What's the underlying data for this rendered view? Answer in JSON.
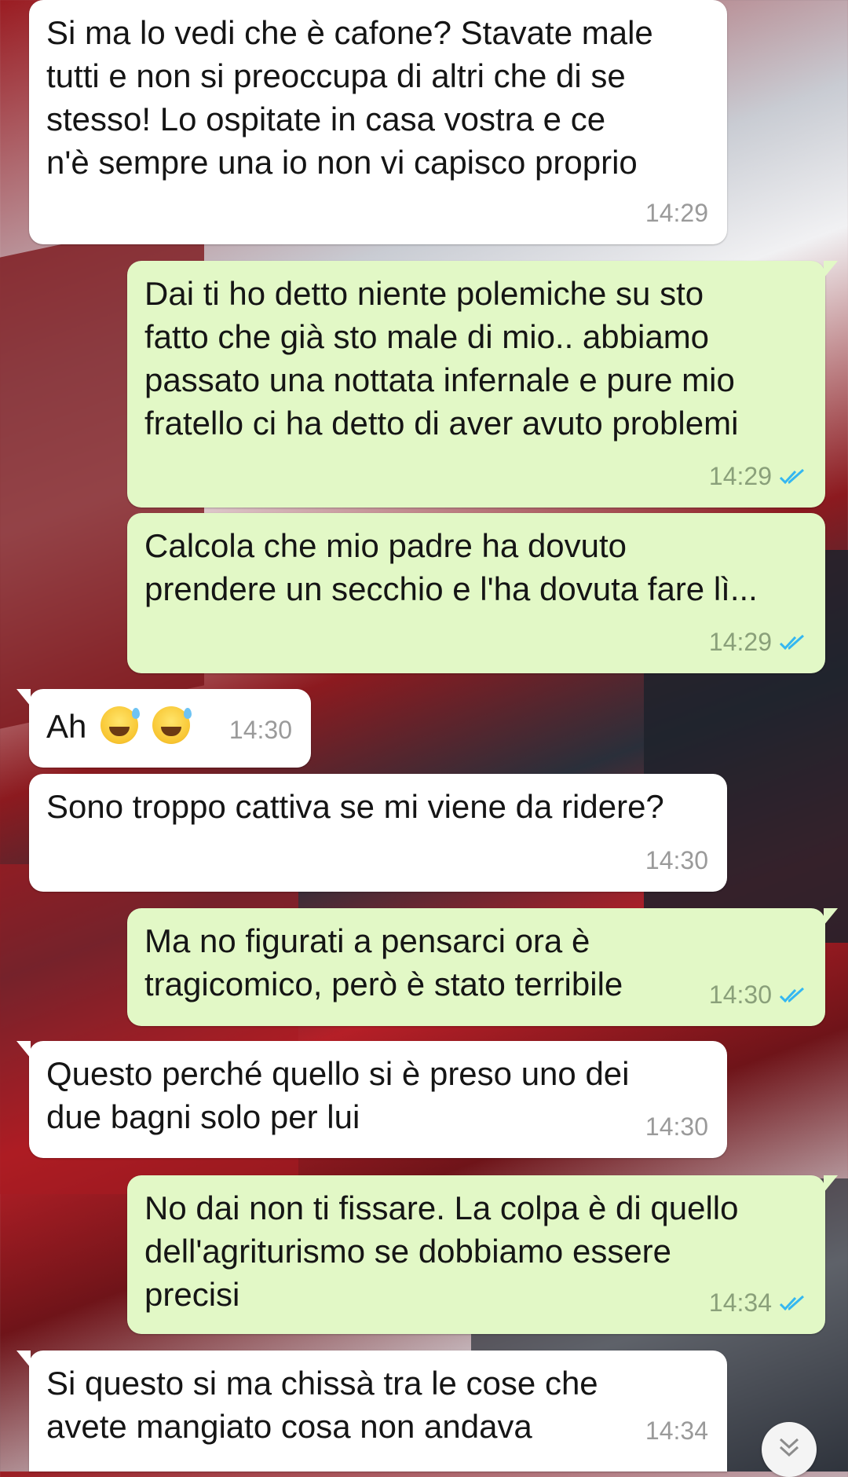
{
  "messages": [
    {
      "side": "in",
      "text": "Si ma lo vedi che è cafone? Stavate male\ntutti e non si preoccupa di altri che di se\nstesso! Lo ospitate in casa vostra e ce\nn'è sempre una io non vi capisco proprio",
      "time": "14:29"
    },
    {
      "side": "out",
      "text": "Dai ti ho detto niente polemiche su sto\nfatto che già sto male di mio.. abbiamo\npassato una nottata infernale e pure mio\nfratello ci ha detto di aver avuto problemi",
      "time": "14:29",
      "status": "read"
    },
    {
      "side": "out",
      "text": "Calcola che mio padre ha dovuto\nprendere un secchio e l'ha dovuta fare lì...",
      "time": "14:29",
      "status": "read"
    },
    {
      "side": "in",
      "text": "Ah",
      "emoji": "grinning-sweat-emoji",
      "time": "14:30"
    },
    {
      "side": "in",
      "text": "Sono troppo cattiva se mi viene da ridere?",
      "time": "14:30"
    },
    {
      "side": "out",
      "text": "Ma no figurati a pensarci ora è\ntragicomico, però è stato terribile",
      "time": "14:30",
      "status": "read"
    },
    {
      "side": "in",
      "text": "Questo perché quello si è preso uno dei\ndue bagni solo per lui",
      "time": "14:30"
    },
    {
      "side": "out",
      "text": "No dai non ti fissare. La colpa è di quello\ndell'agriturismo se dobbiamo essere\nprecisi",
      "time": "14:34",
      "status": "read"
    },
    {
      "side": "in",
      "text": "Si questo si ma chissà tra le cose che\navete mangiato cosa non andava",
      "time": "14:34"
    }
  ],
  "colors": {
    "incoming": "#ffffff",
    "outgoing": "#e2f8c6",
    "read_ticks": "#34b7f1",
    "time": "#9a9a9a"
  },
  "icons": {
    "read": "double-check-icon",
    "scroll": "chevron-double-down-icon"
  }
}
